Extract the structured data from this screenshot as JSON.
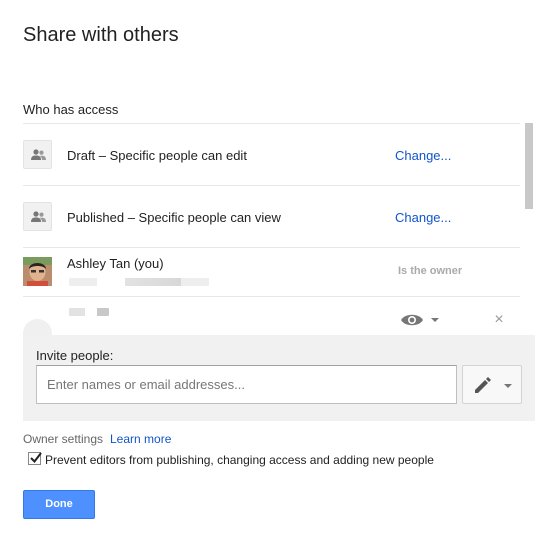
{
  "dialog": {
    "title": "Share with others"
  },
  "access": {
    "heading": "Who has access",
    "rows": [
      {
        "icon": "people-icon",
        "label": "Draft – Specific people can edit",
        "action": "Change..."
      },
      {
        "icon": "people-icon",
        "label": "Published – Specific people can view",
        "action": "Change..."
      }
    ],
    "owner": {
      "name": "Ashley Tan (you)",
      "role": "Is the owner"
    },
    "collaborator": {
      "permission_icon": "eye-icon",
      "remove_icon": "close-icon",
      "remove_symbol": "×"
    }
  },
  "invite": {
    "label": "Invite people:",
    "placeholder": "Enter names or email addresses...",
    "permission_icon": "pencil-icon"
  },
  "owner_settings": {
    "label": "Owner settings",
    "link": "Learn more",
    "checkbox_label": "Prevent editors from publishing, changing access and adding new people",
    "checked": true
  },
  "footer": {
    "done_label": "Done"
  },
  "colors": {
    "link": "#1155cc",
    "primary_button": "#4d90fe",
    "panel": "#f1f1f1"
  }
}
